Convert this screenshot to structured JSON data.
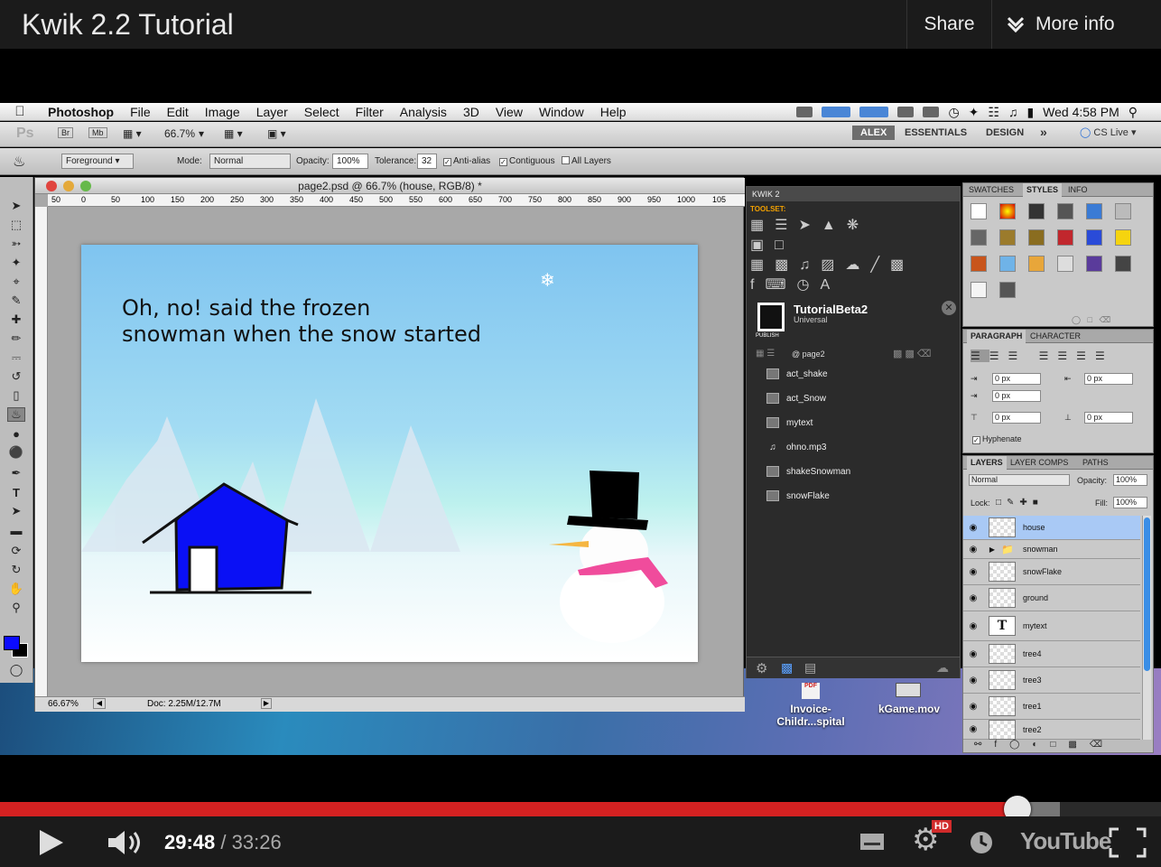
{
  "youtube": {
    "title": "Kwik 2.2 Tutorial",
    "share_label": "Share",
    "more_info_label": "More info",
    "current_time": "29:48",
    "duration": "/ 33:26",
    "progress": 0.8766,
    "buffered": 0.913,
    "hd_badge": "HD",
    "logo": "YouTube"
  },
  "menubar": {
    "items": [
      "Photoshop",
      "File",
      "Edit",
      "Image",
      "Layer",
      "Select",
      "Filter",
      "Analysis",
      "3D",
      "View",
      "Window",
      "Help"
    ],
    "clock": "Wed 4:58 PM"
  },
  "appbar": {
    "logo": "Ps",
    "br": "Br",
    "mb": "Mb",
    "zoom": "66.7%",
    "workspace_active": "ALEX",
    "workspaces": [
      "ESSENTIALS",
      "DESIGN"
    ],
    "chevrons": "»",
    "cs_live": "CS Live"
  },
  "options": {
    "fill_source": "Foreground",
    "mode_label": "Mode:",
    "mode_value": "Normal",
    "opacity_label": "Opacity:",
    "opacity_value": "100%",
    "tolerance_label": "Tolerance:",
    "tolerance_value": "32",
    "anti_alias": "Anti-alias",
    "contiguous": "Contiguous",
    "all_layers": "All Layers"
  },
  "document": {
    "title": "page2.psd @ 66.7% (house, RGB/8) *",
    "ruler_ticks": [
      "50",
      "0",
      "50",
      "100",
      "150",
      "200",
      "250",
      "300",
      "350",
      "400",
      "450",
      "500",
      "550",
      "600",
      "650",
      "700",
      "750",
      "800",
      "850",
      "900",
      "950",
      "1000",
      "105"
    ],
    "zoom_status": "66.67%",
    "doc_size": "Doc: 2.25M/12.7M",
    "story_line1": "Oh, no! said the frozen",
    "story_line2": "snowman when the snow started"
  },
  "kwik": {
    "tab": "KWIK 2",
    "toolset_label": "TOOLSET:",
    "project_name": "TutorialBeta2",
    "project_type": "Universal",
    "publish_label": "PUBLISH",
    "page_label": "@ page2",
    "items": [
      "act_shake",
      "act_Snow",
      "mytext",
      "ohno.mp3",
      "shakeSnowman",
      "snowFlake"
    ]
  },
  "desktop": {
    "file1_line1": "Invoice-",
    "file1_line2": "Childr...spital",
    "file2": "kGame.mov",
    "pdf_label": "PDF"
  },
  "styles_panel": {
    "tabs": [
      "SWATCHES",
      "STYLES",
      "INFO"
    ]
  },
  "paragraph_panel": {
    "tabs": [
      "PARAGRAPH",
      "CHARACTER"
    ],
    "fields": [
      "0 px",
      "0 px",
      "0 px",
      "0 px",
      "0 px"
    ],
    "hyphenate": "Hyphenate"
  },
  "layers_panel": {
    "tabs": [
      "LAYERS",
      "LAYER COMPS",
      "PATHS"
    ],
    "blend_mode": "Normal",
    "opacity_label": "Opacity:",
    "opacity_value": "100%",
    "lock_label": "Lock:",
    "fill_label": "Fill:",
    "fill_value": "100%",
    "layers": [
      "house",
      "snowman",
      "snowFlake",
      "ground",
      "mytext",
      "tree4",
      "tree3",
      "tree1",
      "tree2"
    ],
    "text_thumb": "T"
  },
  "colors": {
    "foreground": "#0b0bff",
    "progress_red": "#d42121",
    "kwik_orange": "#f2a000",
    "house_blue": "#0a10f5"
  }
}
